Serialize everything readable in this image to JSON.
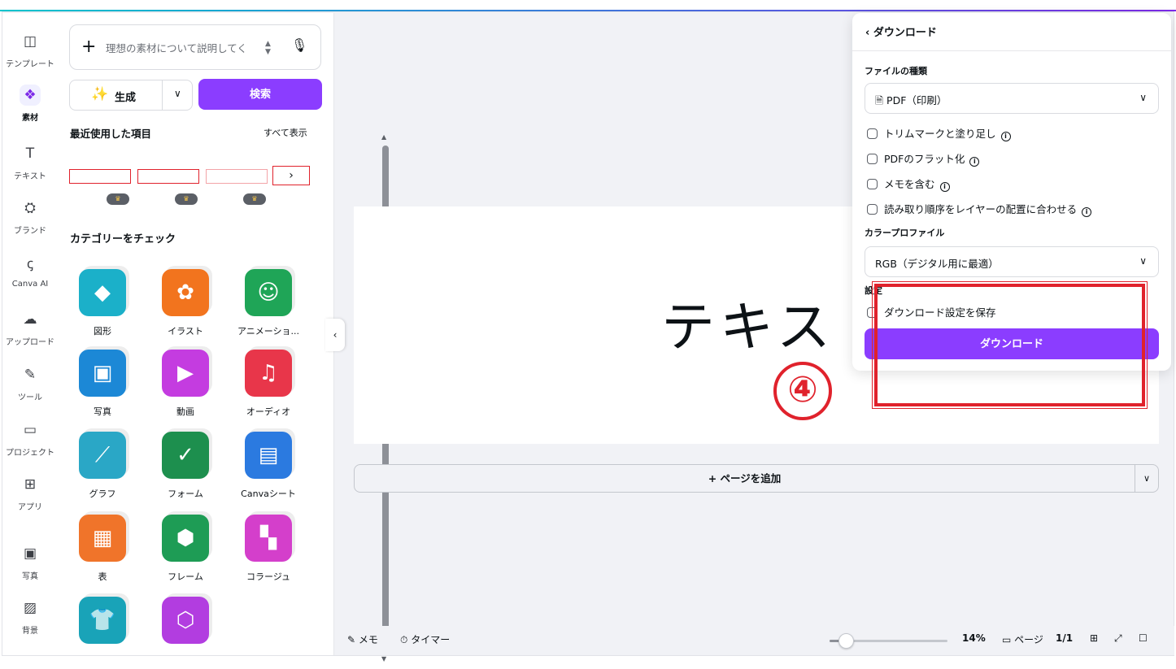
{
  "rail": {
    "items": [
      {
        "label": "テンプレート",
        "icon": "template-icon",
        "glyph": "◫"
      },
      {
        "label": "素材",
        "icon": "elements-icon",
        "glyph": "❖",
        "active": true
      },
      {
        "label": "テキスト",
        "icon": "text-icon",
        "glyph": "T"
      },
      {
        "label": "ブランド",
        "icon": "brand-icon",
        "glyph": "⛭"
      },
      {
        "label": "Canva AI",
        "icon": "canva-ai-icon",
        "glyph": "ꞔ"
      },
      {
        "label": "アップロード",
        "icon": "upload-icon",
        "glyph": "☁"
      },
      {
        "label": "ツール",
        "icon": "tool-icon",
        "glyph": "✎"
      },
      {
        "label": "プロジェクト",
        "icon": "folder-icon",
        "glyph": "▭"
      },
      {
        "label": "アプリ",
        "icon": "apps-icon",
        "glyph": "⊞"
      },
      {
        "label": "写真",
        "icon": "photo-icon",
        "glyph": "▣"
      },
      {
        "label": "背景",
        "icon": "background-icon",
        "glyph": "▨"
      }
    ]
  },
  "panel": {
    "search_placeholder": "理想の素材について説明してく",
    "generate_label": "生成",
    "search_label": "検索",
    "recent_title": "最近使用した項目",
    "see_all": "すべて表示",
    "category_title": "カテゴリーをチェック",
    "categories": [
      {
        "label": "図形",
        "icon": "shapes-icon",
        "glyph": "◆",
        "color": "#1bb0c9"
      },
      {
        "label": "イラスト",
        "icon": "illustration-icon",
        "glyph": "✿",
        "color": "#f2741e"
      },
      {
        "label": "アニメーショ...",
        "icon": "animation-icon",
        "glyph": "☺",
        "color": "#1fa557"
      },
      {
        "label": "写真",
        "icon": "photo-category-icon",
        "glyph": "▣",
        "color": "#1c88d6"
      },
      {
        "label": "動画",
        "icon": "video-icon",
        "glyph": "▶",
        "color": "#c43ce0"
      },
      {
        "label": "オーディオ",
        "icon": "audio-icon",
        "glyph": "♫",
        "color": "#e8364a"
      },
      {
        "label": "グラフ",
        "icon": "graph-icon",
        "glyph": "⟋",
        "color": "#2aa7c6"
      },
      {
        "label": "フォーム",
        "icon": "form-icon",
        "glyph": "✓",
        "color": "#1d8f4e"
      },
      {
        "label": "Canvaシート",
        "icon": "sheet-icon",
        "glyph": "▤",
        "color": "#2b7ae0"
      },
      {
        "label": "表",
        "icon": "table-icon",
        "glyph": "▦",
        "color": "#f0742a"
      },
      {
        "label": "フレーム",
        "icon": "frame-icon",
        "glyph": "⬢",
        "color": "#1e9c55"
      },
      {
        "label": "コラージュ",
        "icon": "collage-icon",
        "glyph": "▚",
        "color": "#d43fcb"
      },
      {
        "label": "",
        "icon": "mockup-icon",
        "glyph": "👕",
        "color": "#19a3b8"
      },
      {
        "label": "",
        "icon": "3d-icon",
        "glyph": "⬡",
        "color": "#b23de0"
      }
    ]
  },
  "canvas": {
    "page_text": "テキスト",
    "step_number": "④",
    "add_page": "+ ページを追加"
  },
  "bottom": {
    "notes": "メモ",
    "timer": "タイマー",
    "zoom": "14%",
    "zoom_level": 0.14,
    "pages_label": "ページ",
    "page_count": "1/1"
  },
  "download": {
    "back_label": "ダウンロード",
    "file_type_title": "ファイルの種類",
    "file_type_value": "PDF（印刷）",
    "options": [
      {
        "label": "トリムマークと塗り足し"
      },
      {
        "label": "PDFのフラット化"
      },
      {
        "label": "メモを含む"
      },
      {
        "label": "読み取り順序をレイヤーの配置に合わせる"
      }
    ],
    "color_profile_title": "カラープロファイル",
    "color_profile_value": "RGB（デジタル用に最適）",
    "settings_title": "設定",
    "save_settings": "ダウンロード設定を保存",
    "download_button": "ダウンロード"
  },
  "colors": {
    "accent": "#8b3dff",
    "highlight": "#e0222c"
  }
}
